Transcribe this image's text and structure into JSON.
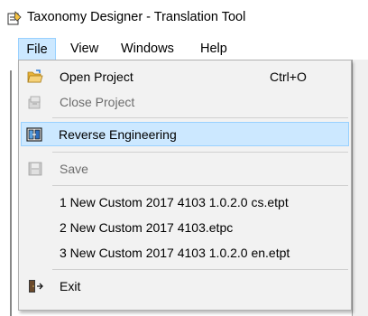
{
  "window": {
    "title": "Taxonomy Designer - Translation Tool",
    "app_icon": "pencil-document-icon"
  },
  "menubar": {
    "items": [
      {
        "label": "File",
        "open": true
      },
      {
        "label": "View"
      },
      {
        "label": "Windows"
      },
      {
        "label": "Help"
      }
    ]
  },
  "file_menu": {
    "open_project": {
      "label": "Open Project",
      "shortcut": "Ctrl+O",
      "icon": "open-folder-icon"
    },
    "close_project": {
      "label": "Close Project",
      "icon": "close-project-icon",
      "disabled": true
    },
    "reverse_engineering": {
      "label": "Reverse Engineering",
      "icon": "reverse-engineering-icon",
      "highlighted": true
    },
    "save": {
      "label": "Save",
      "icon": "floppy-disk-icon",
      "disabled": true
    },
    "recent_files": [
      "1 New Custom 2017 4103 1.0.2.0 cs.etpt",
      "2 New Custom 2017 4103.etpc",
      "3 New Custom 2017 4103 1.0.2.0 en.etpt"
    ],
    "exit": {
      "label": "Exit",
      "icon": "exit-door-icon"
    }
  },
  "colors": {
    "highlight_fill": "#cce8ff",
    "highlight_border": "#99d1ff",
    "menu_background": "#f2f2f2",
    "disabled_text": "#6d6d6d"
  }
}
